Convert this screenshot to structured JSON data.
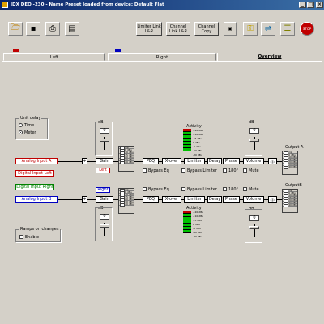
{
  "window": {
    "title": "IDX DEO -230 - Name Preset loaded from device: Default Flat",
    "controls": [
      "_",
      "□",
      "×"
    ]
  },
  "toolbar": {
    "buttons": [
      {
        "label": "Limiter Link L&R"
      },
      {
        "label": "Channel Link L&R"
      },
      {
        "label": "Channel Copy"
      }
    ]
  },
  "tabs": [
    {
      "label": "Left"
    },
    {
      "label": "Right"
    },
    {
      "label": "Overview"
    }
  ],
  "unit_delay": {
    "title": "Unit delay",
    "options": [
      "Time",
      "Meter"
    ],
    "selected": "Meter"
  },
  "ramps": {
    "title": "Ramps on changes",
    "enable_label": "Enable"
  },
  "inputs": {
    "analog_a": "Analog Input A",
    "digital_left": "Digital Input Left",
    "digital_right": "Digital Input Right",
    "analog_b": "Analog Input B"
  },
  "channel_a": {
    "gain": "Gain",
    "side": "Left",
    "db_label": "dB",
    "gain_value": "0",
    "chain": [
      "PEQ",
      "X-over",
      "Limiter",
      "Delay",
      "Phase",
      "Volume"
    ],
    "bypass_eq": "Bypass Eq",
    "bypass_limiter": "Bypass Limiter",
    "phase_label": "180°",
    "mute": "Mute",
    "activity": "Activity",
    "output": "Output A",
    "vol_db_label": "dB",
    "vol_value": "0"
  },
  "channel_b": {
    "gain": "Gain",
    "side": "Right",
    "db_label": "dB",
    "gain_value": "0",
    "chain": [
      "PEQ",
      "X-over",
      "Limiter",
      "Delay",
      "Phase",
      "Volume"
    ],
    "bypass_eq": "Bypass Eq",
    "bypass_limiter": "Bypass Limiter",
    "phase_label": "180°",
    "mute": "Mute",
    "activity": "Activity",
    "output": "OutputB",
    "vol_db_label": "dB",
    "vol_value": "0"
  },
  "meter_levels": [
    "Clip",
    "-6 dBu",
    "-10 dBu",
    "-15 dBu",
    "-20 dBu",
    "-30 dBu",
    "-40 dBu"
  ],
  "activity_levels": [
    "+20 dBu",
    "+10 dBu",
    "+5 dBu",
    "0 dBu",
    "-5 dBu",
    "-10 dBu",
    "-20 dBu"
  ],
  "colors": {
    "analog": "#c00000",
    "digital_left": "#c00000",
    "digital_right": "#008000",
    "analog_b": "#0000c0",
    "activity_green": "#00c000",
    "activity_red": "#c00000"
  }
}
